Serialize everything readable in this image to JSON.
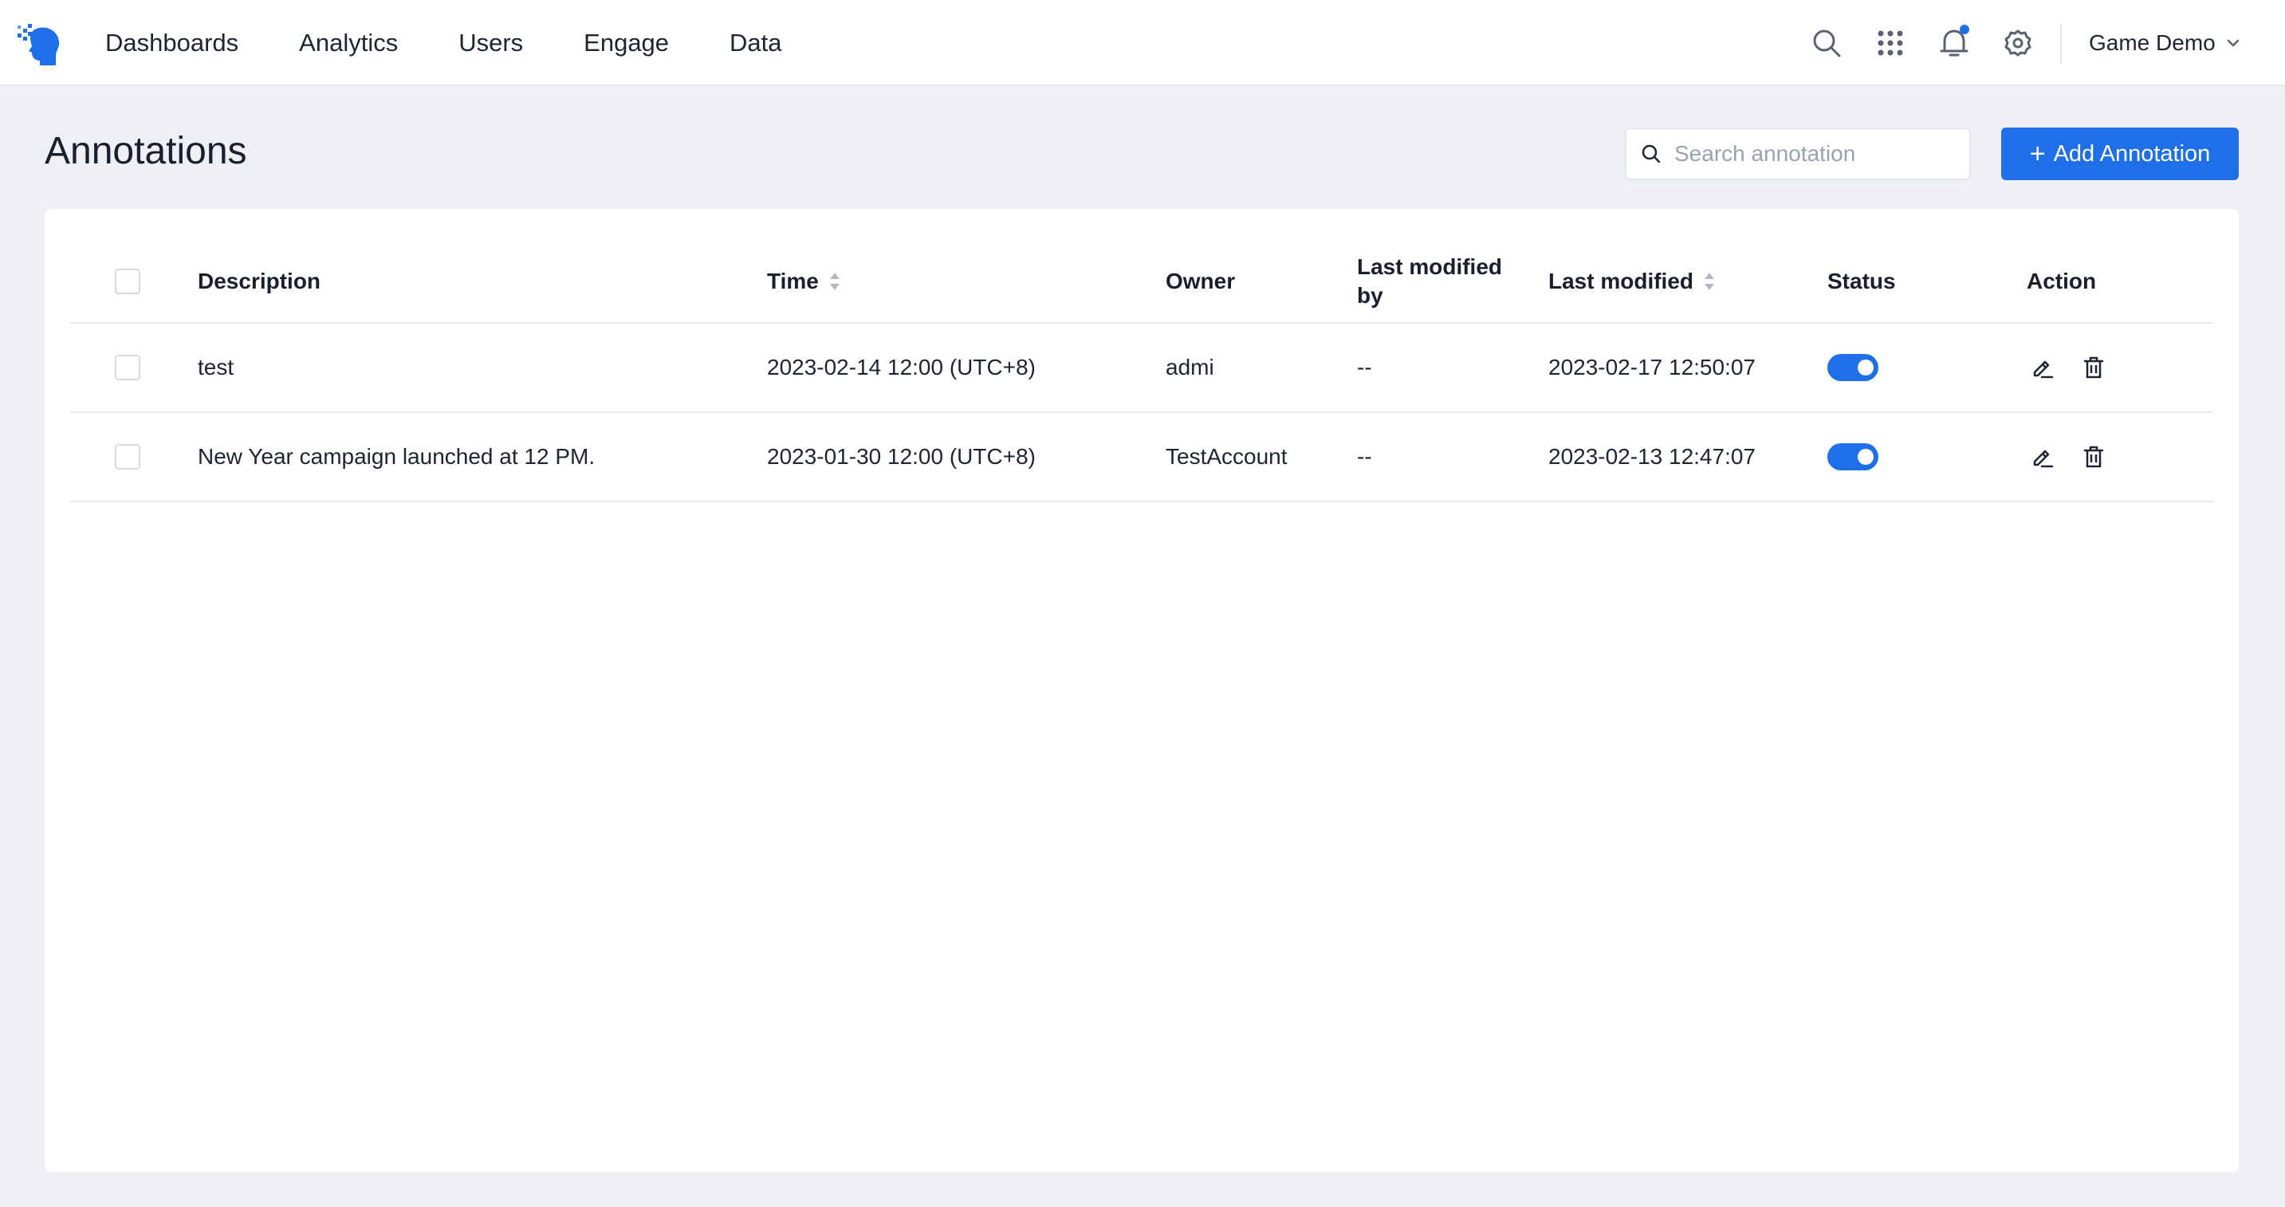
{
  "nav": {
    "items": [
      "Dashboards",
      "Analytics",
      "Users",
      "Engage",
      "Data"
    ],
    "project": "Game Demo",
    "icons": [
      "search-icon",
      "apps-grid-icon",
      "bell-icon",
      "gear-icon"
    ]
  },
  "page": {
    "title": "Annotations",
    "search_placeholder": "Search annotation",
    "add_button_label": "Add Annotation",
    "add_button_plus": "+"
  },
  "table": {
    "columns": {
      "description": "Description",
      "time": "Time",
      "owner": "Owner",
      "last_modified_by": "Last modified by",
      "last_modified": "Last modified",
      "status": "Status",
      "action": "Action"
    },
    "rows": [
      {
        "description": "test",
        "time": "2023-02-14 12:00 (UTC+8)",
        "owner": "admi",
        "last_modified_by": "--",
        "last_modified": "2023-02-17 12:50:07",
        "status_enabled": true
      },
      {
        "description": "New Year campaign launched at 12 PM.",
        "time": "2023-01-30 12:00 (UTC+8)",
        "owner": "TestAccount",
        "last_modified_by": "--",
        "last_modified": "2023-02-13 12:47:07",
        "status_enabled": true
      }
    ]
  },
  "colors": {
    "accent": "#1f6fe8",
    "background": "#eef0f5",
    "text": "#1f2433"
  }
}
